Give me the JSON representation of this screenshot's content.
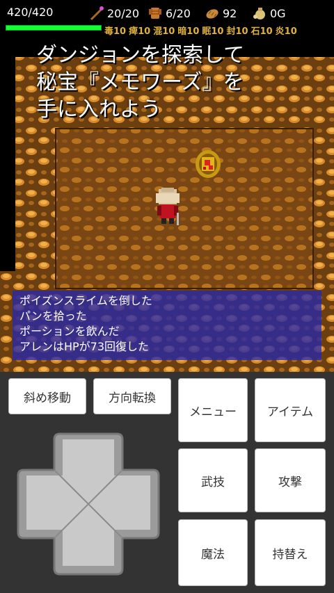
{
  "hud": {
    "hp_text": "420/420",
    "hp_fraction": 1.0,
    "weapon_count": "20/20",
    "armor_count": "6/20",
    "food_count": "92",
    "gold_text": "0G",
    "status_effects": [
      "毒10",
      "痺10",
      "混10",
      "暗10",
      "眠10",
      "封10",
      "石10",
      "炎10"
    ]
  },
  "banner": {
    "line1": "ダンジョンを探索して",
    "line2": "秘宝『メモワーズ』を",
    "line3": "手に入れよう"
  },
  "messages": [
    "ポイズンスライムを倒した",
    "パンを拾った",
    "ポーションを飲んだ",
    "アレンはHPが73回復した"
  ],
  "controls": {
    "diagonal_move": "斜め移動",
    "turn": "方向転換",
    "menu": "メニュー",
    "item": "アイテム",
    "skill": "武技",
    "attack": "攻撃",
    "magic": "魔法",
    "swap": "持替え"
  },
  "icons": {
    "weapon": "staff-icon",
    "armor": "armor-icon",
    "food": "bread-icon",
    "gold": "money-bag-icon"
  },
  "colors": {
    "hp_bar": "#11ff33",
    "status_text": "#e1b23a",
    "message_bg": "#2828aa"
  }
}
